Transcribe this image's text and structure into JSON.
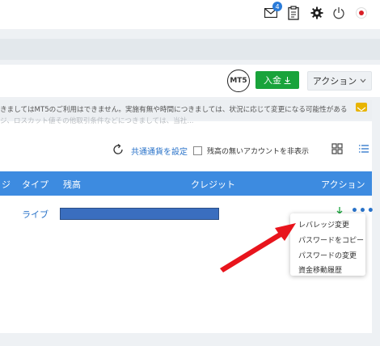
{
  "topbar": {
    "mail_badge_count": "4",
    "icons": [
      "mail-icon",
      "clipboard-icon",
      "gear-icon",
      "power-icon",
      "flag-japan-icon"
    ]
  },
  "account_row": {
    "platform_badge": "MT5",
    "deposit_label": "入金",
    "action_label": "アクション"
  },
  "notice": {
    "text": "きましてはMT5のご利用はできません。実施有無や時間につきましては、状況に応じて変更になる可能性がある",
    "text_faded": "ジ、ロスカット値その他取引条件などにつきましては、当社..."
  },
  "toolbar": {
    "currency_link": "共通通貨を設定",
    "hide_zero_label": "残高の無いアカウントを非表示"
  },
  "table": {
    "headers": [
      "ジ",
      "タイプ",
      "残高",
      "クレジット",
      "アクション"
    ],
    "rows": [
      {
        "type": "ライブ"
      }
    ]
  },
  "dropdown_menu": {
    "items": [
      "レバレッジ変更",
      "パスワードをコピー",
      "パスワードの変更",
      "資金移動履歴"
    ]
  },
  "colors": {
    "accent_blue": "#3d8be0",
    "deposit_green": "#19a33b",
    "annotation_red": "#e8141c"
  }
}
